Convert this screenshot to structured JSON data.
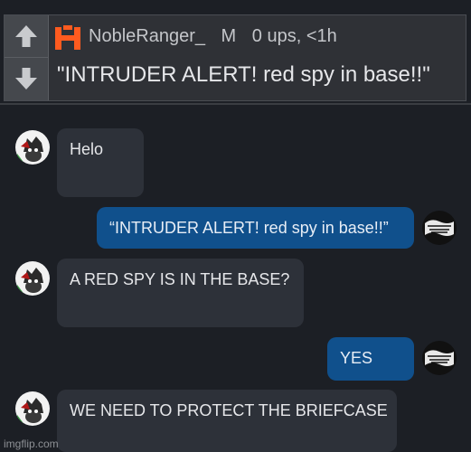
{
  "post": {
    "author": "NobleRanger_",
    "flair": "M",
    "meta": "0 ups, <1h",
    "title": "\"INTRUDER ALERT! red spy in base!!\"",
    "upvote_icon": "arrow-up-icon",
    "downvote_icon": "arrow-down-icon",
    "logo_icon": "site-logo",
    "colors": {
      "panel": "#2f3136",
      "vote": "#45484d",
      "logo": "#ff5b1f"
    }
  },
  "chat": {
    "messages": [
      {
        "side": "received",
        "text": "Helo"
      },
      {
        "side": "sent",
        "text": "“INTRUDER ALERT! red spy in base!!”"
      },
      {
        "side": "received",
        "text": "A RED SPY IS IN THE BASE?"
      },
      {
        "side": "sent",
        "text": "YES"
      },
      {
        "side": "received",
        "text": "WE NEED TO PROTECT THE BRIEFCASE"
      }
    ],
    "colors": {
      "background": "#1c1f25",
      "received": "#2d3139",
      "sent": "#10508c"
    }
  },
  "watermark": "imgflip.com"
}
